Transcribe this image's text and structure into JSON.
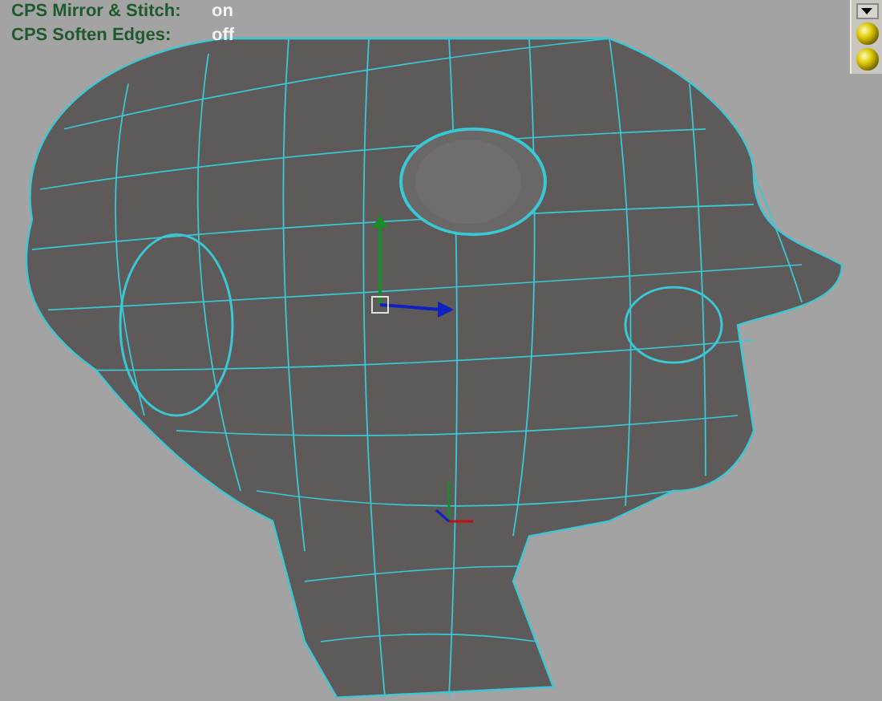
{
  "hud_lines": [
    {
      "label": "CPS Mirror & Stitch:",
      "value": "on"
    },
    {
      "label": "CPS Soften Edges:",
      "value": "off"
    }
  ],
  "side_panel": {
    "tools": [
      {
        "kind": "dropdown"
      },
      {
        "kind": "sphere"
      },
      {
        "kind": "sphere"
      }
    ]
  }
}
